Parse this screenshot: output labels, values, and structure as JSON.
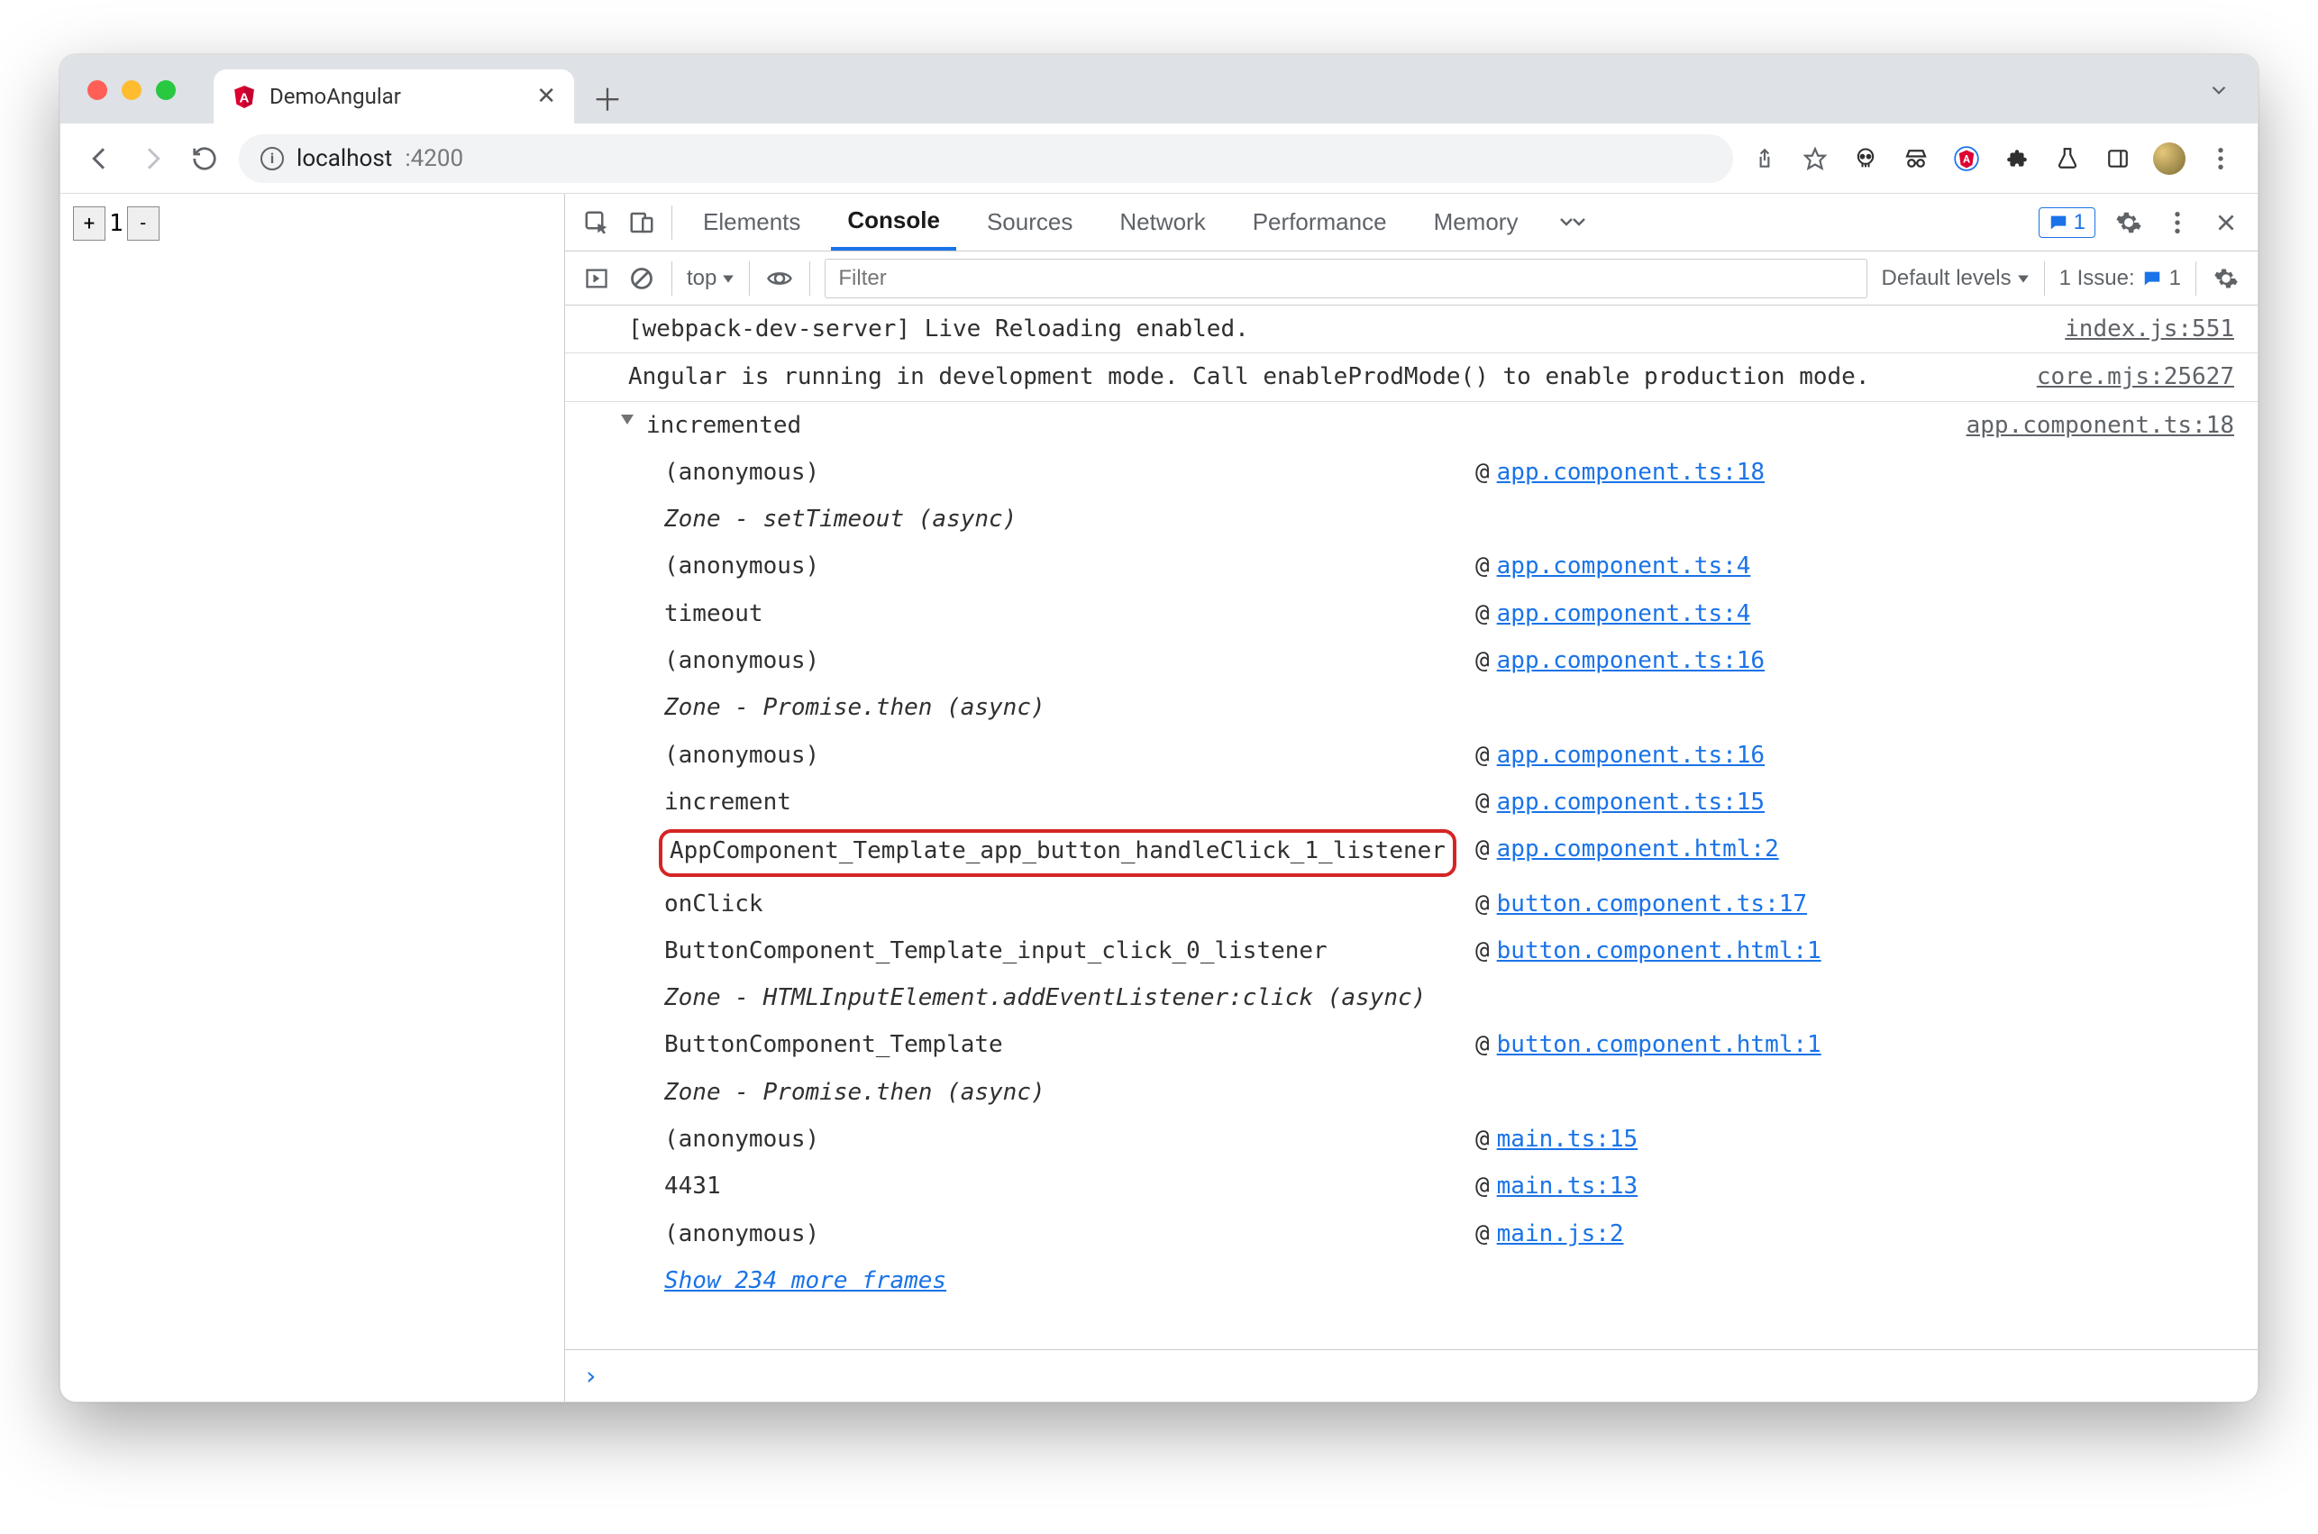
{
  "chrome": {
    "tab_title": "DemoAngular",
    "url_host": "localhost",
    "url_port": ":4200"
  },
  "page": {
    "counter_plus": "+",
    "counter_value": "1",
    "counter_minus": "-"
  },
  "devtools": {
    "tabs": [
      "Elements",
      "Console",
      "Sources",
      "Network",
      "Performance",
      "Memory"
    ],
    "active_tab": "Console",
    "badge_count": "1",
    "context": "top",
    "filter_placeholder": "Filter",
    "levels_label": "Default levels",
    "issues_label": "1 Issue:",
    "issues_count": "1"
  },
  "console": {
    "msg1": {
      "text": "[webpack-dev-server] Live Reloading enabled.",
      "link": "index.js:551"
    },
    "msg2": {
      "text": "Angular is running in development mode. Call enableProdMode() to enable production mode.",
      "link": "core.mjs:25627"
    },
    "msg3": {
      "text": "incremented",
      "link": "app.component.ts:18"
    },
    "trace": [
      {
        "name": "(anonymous)",
        "link": "app.component.ts:18"
      },
      {
        "zone": "Zone - setTimeout (async)"
      },
      {
        "name": "(anonymous)",
        "link": "app.component.ts:4"
      },
      {
        "name": "timeout",
        "link": "app.component.ts:4"
      },
      {
        "name": "(anonymous)",
        "link": "app.component.ts:16"
      },
      {
        "zone": "Zone - Promise.then (async)"
      },
      {
        "name": "(anonymous)",
        "link": "app.component.ts:16"
      },
      {
        "name": "increment",
        "link": "app.component.ts:15"
      },
      {
        "name": "AppComponent_Template_app_button_handleClick_1_listener",
        "link": "app.component.html:2",
        "highlight": true
      },
      {
        "name": "onClick",
        "link": "button.component.ts:17"
      },
      {
        "name": "ButtonComponent_Template_input_click_0_listener",
        "link": "button.component.html:1"
      },
      {
        "zone": "Zone - HTMLInputElement.addEventListener:click (async)"
      },
      {
        "name": "ButtonComponent_Template",
        "link": "button.component.html:1"
      },
      {
        "zone": "Zone - Promise.then (async)"
      },
      {
        "name": "(anonymous)",
        "link": "main.ts:15"
      },
      {
        "name": "4431",
        "link": "main.ts:13"
      },
      {
        "name": "(anonymous)",
        "link": "main.js:2"
      }
    ],
    "show_more": "Show 234 more frames",
    "prompt": ">"
  }
}
